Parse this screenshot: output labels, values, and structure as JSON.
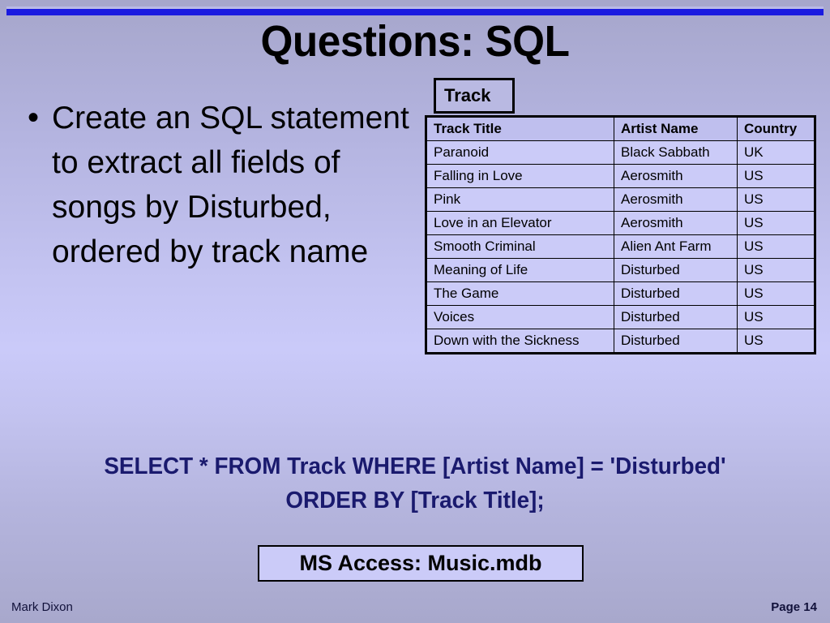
{
  "slide": {
    "title": "Questions: SQL",
    "accent_rule_color": "#1a1ae0",
    "background_top_color": "#a6a6cb",
    "background_mid_color": "#cacaf9"
  },
  "body": {
    "bullet_marker": "•",
    "bullet_text": "Create an SQL statement to extract all fields of songs by Disturbed, ordered by track name"
  },
  "table": {
    "label": "Track",
    "columns": [
      "Track Title",
      "Artist Name",
      "Country"
    ],
    "rows": [
      [
        "Paranoid",
        "Black Sabbath",
        "UK"
      ],
      [
        "Falling in Love",
        "Aerosmith",
        "US"
      ],
      [
        "Pink",
        "Aerosmith",
        "US"
      ],
      [
        "Love in an Elevator",
        "Aerosmith",
        "US"
      ],
      [
        "Smooth Criminal",
        "Alien Ant Farm",
        "US"
      ],
      [
        "Meaning of Life",
        "Disturbed",
        "US"
      ],
      [
        "The Game",
        "Disturbed",
        "US"
      ],
      [
        "Voices",
        "Disturbed",
        "US"
      ],
      [
        "Down with the Sickness",
        "Disturbed",
        "US"
      ]
    ]
  },
  "answer": {
    "line1": "SELECT * FROM Track WHERE [Artist Name] = 'Disturbed'",
    "line2": "ORDER BY [Track Title];",
    "color": "#1a1a6e"
  },
  "source_box": {
    "label": "MS Access: Music.mdb"
  },
  "footer": {
    "author": "Mark Dixon",
    "page": "Page 14"
  }
}
